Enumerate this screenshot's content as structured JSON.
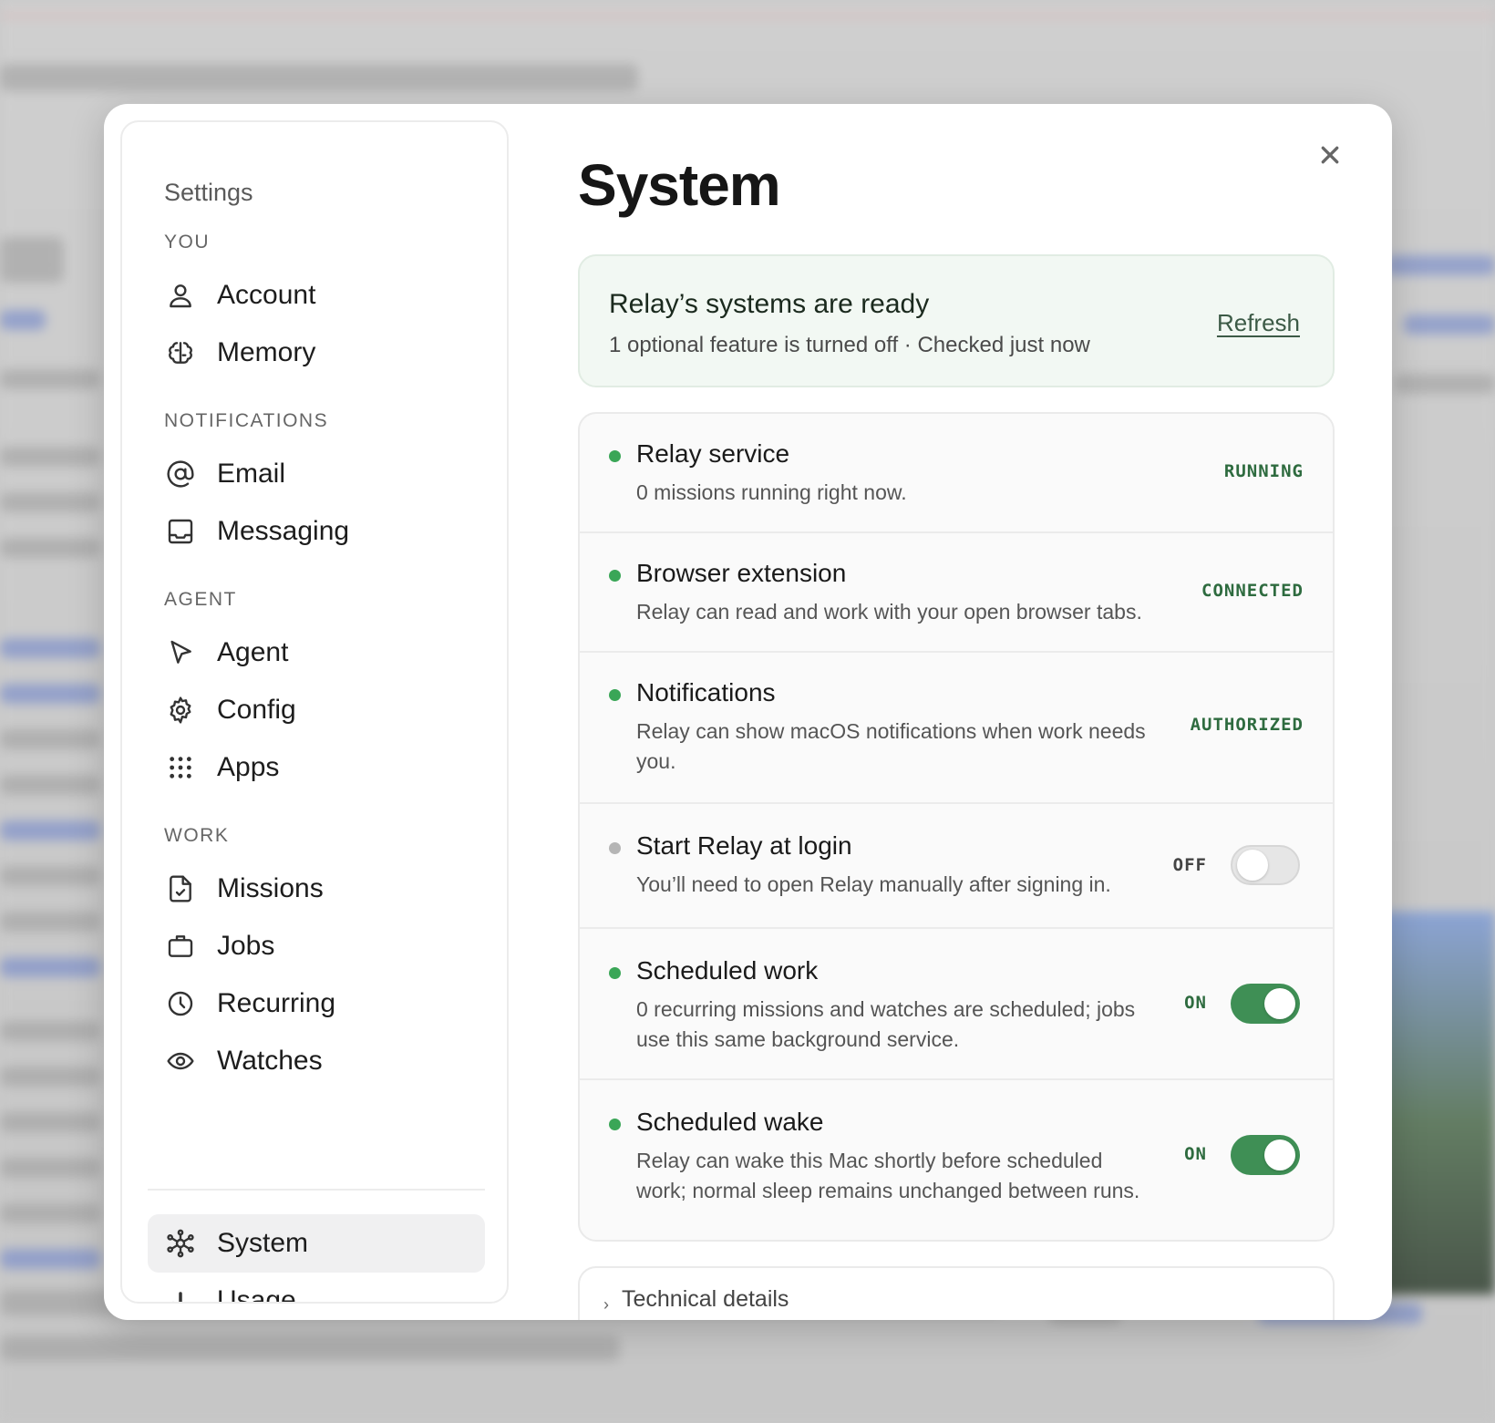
{
  "sidebar": {
    "title": "Settings",
    "sections": {
      "you": "YOU",
      "notifications": "NOTIFICATIONS",
      "agent": "AGENT",
      "work": "WORK"
    },
    "items": {
      "account": "Account",
      "memory": "Memory",
      "email": "Email",
      "messaging": "Messaging",
      "agent": "Agent",
      "config": "Config",
      "apps": "Apps",
      "missions": "Missions",
      "jobs": "Jobs",
      "recurring": "Recurring",
      "watches": "Watches",
      "system": "System",
      "usage": "Usage"
    },
    "active": "system"
  },
  "main": {
    "title": "System",
    "ready": {
      "title": "Relay’s systems are ready",
      "subtitle": "1 optional feature is turned off · Checked just now",
      "refresh": "Refresh"
    },
    "rows": [
      {
        "title": "Relay service",
        "desc": "0 missions running right now.",
        "status": "RUNNING",
        "dot": "green"
      },
      {
        "title": "Browser extension",
        "desc": "Relay can read and work with your open browser tabs.",
        "status": "CONNECTED",
        "dot": "green"
      },
      {
        "title": "Notifications",
        "desc": "Relay can show macOS notifications when work needs you.",
        "status": "AUTHORIZED",
        "dot": "green"
      },
      {
        "title": "Start Relay at login",
        "desc": "You’ll need to open Relay manually after signing in.",
        "status": "OFF",
        "dot": "gray",
        "toggle": false
      },
      {
        "title": "Scheduled work",
        "desc": "0 recurring missions and watches are scheduled; jobs use this same background service.",
        "status": "ON",
        "dot": "green",
        "toggle": true
      },
      {
        "title": "Scheduled wake",
        "desc": "Relay can wake this Mac shortly before scheduled work; normal sleep remains unchanged between runs.",
        "status": "ON",
        "dot": "green",
        "toggle": true
      }
    ],
    "technical": "Technical details"
  },
  "colors": {
    "accent_green": "#3f8f55",
    "status_green": "#2e6b3f",
    "ready_bg": "#f2f8f3"
  }
}
